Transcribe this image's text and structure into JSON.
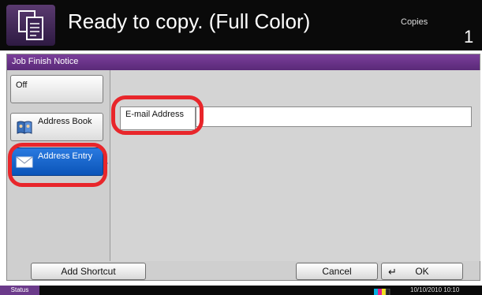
{
  "header": {
    "title": "Ready to copy. (Full Color)",
    "copies_label": "Copies",
    "copies_value": "1"
  },
  "panel": {
    "title": "Job Finish Notice",
    "side_buttons": {
      "off": "Off",
      "address_book": "Address Book",
      "address_entry": "Address Entry"
    },
    "email_button": "E-mail Address",
    "email_value": ""
  },
  "footer": {
    "add_shortcut": "Add Shortcut",
    "cancel": "Cancel",
    "ok": "OK"
  },
  "status_bar": {
    "status": "Status",
    "datetime": "10/10/2010  10:10"
  },
  "colors": {
    "title_bar": "#5a2a78",
    "selected_button": "#0a54b8",
    "highlight_ring": "#e8262b",
    "status_button": "#6b3a8a"
  },
  "icons": [
    "copy-mode-icon",
    "address-book-icon",
    "envelope-icon",
    "enter-icon",
    "toner-level-icon"
  ]
}
